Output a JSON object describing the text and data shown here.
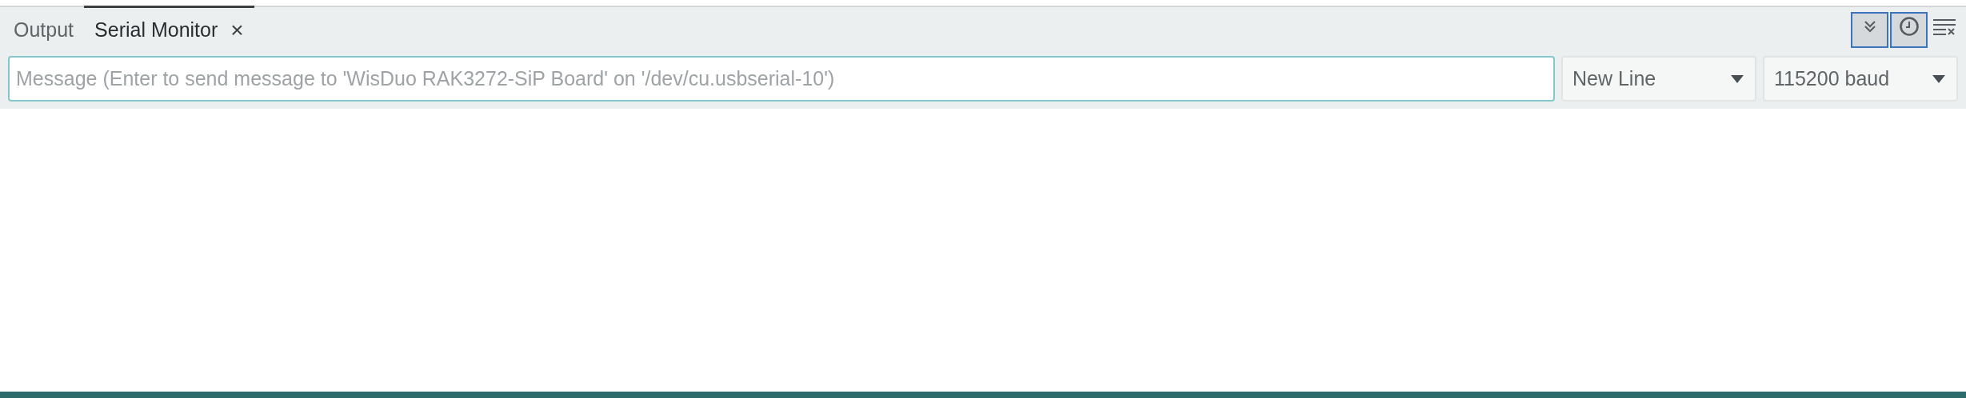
{
  "tabs": [
    {
      "label": "Output",
      "selected": false
    },
    {
      "label": "Serial Monitor",
      "selected": true,
      "close": "×"
    }
  ],
  "toolbar": {
    "toggles": [
      {
        "kind": "autoscroll",
        "on": true
      },
      {
        "kind": "timestamp",
        "on": true
      }
    ]
  },
  "message": {
    "placeholder": "Message (Enter to send message to 'WisDuo RAK3272-SiP Board' on '/dev/cu.usbserial-10')"
  },
  "line_ending": {
    "value": "New Line"
  },
  "baud_rate": {
    "value": "115200 baud"
  }
}
